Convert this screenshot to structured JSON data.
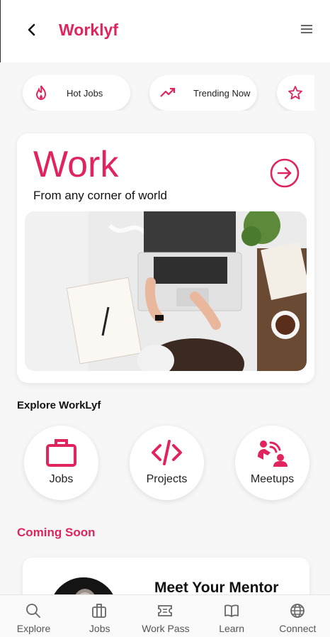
{
  "header": {
    "title": "Worklyf",
    "back_icon": "arrow-left-icon",
    "menu_icon": "menu-icon"
  },
  "chips": [
    {
      "label": "Hot Jobs",
      "icon": "fire-icon"
    },
    {
      "label": "Trending Now",
      "icon": "trending-up-icon"
    },
    {
      "label": "",
      "icon": "star-icon"
    }
  ],
  "work_card": {
    "title": "Work",
    "subtitle": "From any corner of world",
    "arrow_icon": "arrow-right-circle-icon"
  },
  "explore": {
    "title": "Explore WorkLyf",
    "items": [
      {
        "label": "Jobs",
        "icon": "briefcase-icon"
      },
      {
        "label": "Projects",
        "icon": "code-icon"
      },
      {
        "label": "Meetups",
        "icon": "meetup-icon"
      }
    ]
  },
  "coming_soon": {
    "title": "Coming Soon",
    "mentor_title": "Meet Your Mentor"
  },
  "bottom_nav": [
    {
      "label": "Explore",
      "icon": "search-icon"
    },
    {
      "label": "Jobs",
      "icon": "briefcase-icon"
    },
    {
      "label": "Work Pass",
      "icon": "ticket-icon"
    },
    {
      "label": "Learn",
      "icon": "book-icon"
    },
    {
      "label": "Connect",
      "icon": "globe-icon"
    }
  ],
  "colors": {
    "accent": "#e0245e",
    "background": "#f7f7f7",
    "card": "#ffffff",
    "nav_text": "#555555"
  }
}
